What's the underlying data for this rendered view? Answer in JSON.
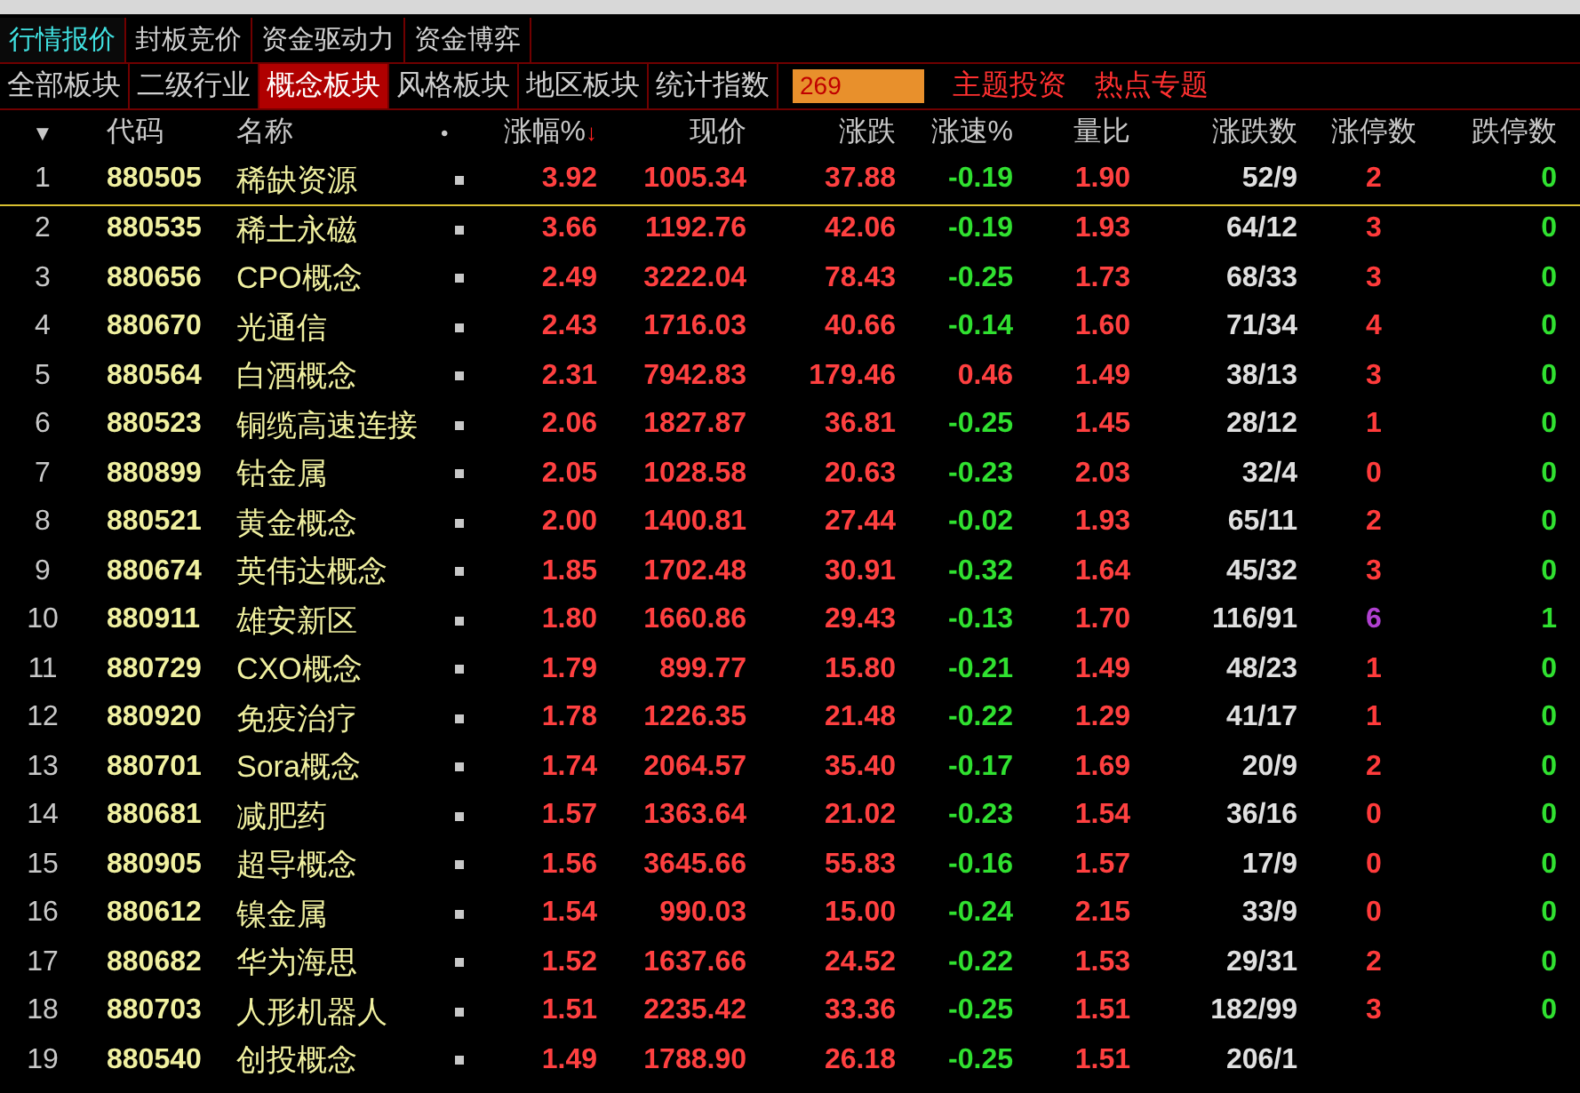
{
  "top_tabs": [
    {
      "label": "行情报价",
      "selected": true
    },
    {
      "label": "封板竞价",
      "selected": false
    },
    {
      "label": "资金驱动力",
      "selected": false
    },
    {
      "label": "资金博弈",
      "selected": false
    }
  ],
  "category_tabs": [
    {
      "label": "全部板块",
      "selected": false
    },
    {
      "label": "二级行业",
      "selected": false
    },
    {
      "label": "概念板块",
      "selected": true
    },
    {
      "label": "风格板块",
      "selected": false
    },
    {
      "label": "地区板块",
      "selected": false
    },
    {
      "label": "统计指数",
      "selected": false
    }
  ],
  "count_field": {
    "value": "269"
  },
  "links": [
    "主题投资",
    "热点专题"
  ],
  "columns": {
    "menu": "▼",
    "code": "代码",
    "name": "名称",
    "dot": "•",
    "change_pct": "涨幅%",
    "sort_mark": "↓",
    "price": "现价",
    "change": "涨跌",
    "speed": "涨速%",
    "volume_ratio": "量比",
    "up_down": "涨跌数",
    "limit_up": "涨停数",
    "limit_down": "跌停数"
  },
  "rows": [
    {
      "index": "1",
      "code": "880505",
      "name": "稀缺资源",
      "change_pct": "3.92",
      "price": "1005.34",
      "change": "37.88",
      "speed": "-0.19",
      "speed_rising": false,
      "volume_ratio": "1.90",
      "up_down": "52/9",
      "limit_up": {
        "text": "2",
        "color": "#ff3b3b"
      },
      "limit_down": "0",
      "selected": true
    },
    {
      "index": "2",
      "code": "880535",
      "name": "稀土永磁",
      "change_pct": "3.66",
      "price": "1192.76",
      "change": "42.06",
      "speed": "-0.19",
      "speed_rising": false,
      "volume_ratio": "1.93",
      "up_down": "64/12",
      "limit_up": {
        "text": "3",
        "color": "#ff3b3b"
      },
      "limit_down": "0",
      "selected": false
    },
    {
      "index": "3",
      "code": "880656",
      "name": "CPO概念",
      "change_pct": "2.49",
      "price": "3222.04",
      "change": "78.43",
      "speed": "-0.25",
      "speed_rising": false,
      "volume_ratio": "1.73",
      "up_down": "68/33",
      "limit_up": {
        "text": "3",
        "color": "#ff3b3b"
      },
      "limit_down": "0",
      "selected": false
    },
    {
      "index": "4",
      "code": "880670",
      "name": "光通信",
      "change_pct": "2.43",
      "price": "1716.03",
      "change": "40.66",
      "speed": "-0.14",
      "speed_rising": false,
      "volume_ratio": "1.60",
      "up_down": "71/34",
      "limit_up": {
        "text": "4",
        "color": "#ff3b3b"
      },
      "limit_down": "0",
      "selected": false
    },
    {
      "index": "5",
      "code": "880564",
      "name": "白酒概念",
      "change_pct": "2.31",
      "price": "7942.83",
      "change": "179.46",
      "speed": "0.46",
      "speed_rising": true,
      "volume_ratio": "1.49",
      "up_down": "38/13",
      "limit_up": {
        "text": "3",
        "color": "#ff3b3b"
      },
      "limit_down": "0",
      "selected": false
    },
    {
      "index": "6",
      "code": "880523",
      "name": "铜缆高速连接",
      "change_pct": "2.06",
      "price": "1827.87",
      "change": "36.81",
      "speed": "-0.25",
      "speed_rising": false,
      "volume_ratio": "1.45",
      "up_down": "28/12",
      "limit_up": {
        "text": "1",
        "color": "#ff3b3b"
      },
      "limit_down": "0",
      "selected": false
    },
    {
      "index": "7",
      "code": "880899",
      "name": "钴金属",
      "change_pct": "2.05",
      "price": "1028.58",
      "change": "20.63",
      "speed": "-0.23",
      "speed_rising": false,
      "volume_ratio": "2.03",
      "up_down": "32/4",
      "limit_up": {
        "text": "0",
        "color": "#ff3b3b"
      },
      "limit_down": "0",
      "selected": false
    },
    {
      "index": "8",
      "code": "880521",
      "name": "黄金概念",
      "change_pct": "2.00",
      "price": "1400.81",
      "change": "27.44",
      "speed": "-0.02",
      "speed_rising": false,
      "volume_ratio": "1.93",
      "up_down": "65/11",
      "limit_up": {
        "text": "2",
        "color": "#ff3b3b"
      },
      "limit_down": "0",
      "selected": false
    },
    {
      "index": "9",
      "code": "880674",
      "name": "英伟达概念",
      "change_pct": "1.85",
      "price": "1702.48",
      "change": "30.91",
      "speed": "-0.32",
      "speed_rising": false,
      "volume_ratio": "1.64",
      "up_down": "45/32",
      "limit_up": {
        "text": "3",
        "color": "#ff3b3b"
      },
      "limit_down": "0",
      "selected": false
    },
    {
      "index": "10",
      "code": "880911",
      "name": "雄安新区",
      "change_pct": "1.80",
      "price": "1660.86",
      "change": "29.43",
      "speed": "-0.13",
      "speed_rising": false,
      "volume_ratio": "1.70",
      "up_down": "116/91",
      "limit_up": {
        "text": "6",
        "color": "#b040d0"
      },
      "limit_down": "1",
      "selected": false
    },
    {
      "index": "11",
      "code": "880729",
      "name": "CXO概念",
      "change_pct": "1.79",
      "price": "899.77",
      "change": "15.80",
      "speed": "-0.21",
      "speed_rising": false,
      "volume_ratio": "1.49",
      "up_down": "48/23",
      "limit_up": {
        "text": "1",
        "color": "#ff3b3b"
      },
      "limit_down": "0",
      "selected": false
    },
    {
      "index": "12",
      "code": "880920",
      "name": "免疫治疗",
      "change_pct": "1.78",
      "price": "1226.35",
      "change": "21.48",
      "speed": "-0.22",
      "speed_rising": false,
      "volume_ratio": "1.29",
      "up_down": "41/17",
      "limit_up": {
        "text": "1",
        "color": "#ff3b3b"
      },
      "limit_down": "0",
      "selected": false
    },
    {
      "index": "13",
      "code": "880701",
      "name": "Sora概念",
      "change_pct": "1.74",
      "price": "2064.57",
      "change": "35.40",
      "speed": "-0.17",
      "speed_rising": false,
      "volume_ratio": "1.69",
      "up_down": "20/9",
      "limit_up": {
        "text": "2",
        "color": "#ff3b3b"
      },
      "limit_down": "0",
      "selected": false
    },
    {
      "index": "14",
      "code": "880681",
      "name": "减肥药",
      "change_pct": "1.57",
      "price": "1363.64",
      "change": "21.02",
      "speed": "-0.23",
      "speed_rising": false,
      "volume_ratio": "1.54",
      "up_down": "36/16",
      "limit_up": {
        "text": "0",
        "color": "#ff3b3b"
      },
      "limit_down": "0",
      "selected": false
    },
    {
      "index": "15",
      "code": "880905",
      "name": "超导概念",
      "change_pct": "1.56",
      "price": "3645.66",
      "change": "55.83",
      "speed": "-0.16",
      "speed_rising": false,
      "volume_ratio": "1.57",
      "up_down": "17/9",
      "limit_up": {
        "text": "0",
        "color": "#ff3b3b"
      },
      "limit_down": "0",
      "selected": false
    },
    {
      "index": "16",
      "code": "880612",
      "name": "镍金属",
      "change_pct": "1.54",
      "price": "990.03",
      "change": "15.00",
      "speed": "-0.24",
      "speed_rising": false,
      "volume_ratio": "2.15",
      "up_down": "33/9",
      "limit_up": {
        "text": "0",
        "color": "#ff3b3b"
      },
      "limit_down": "0",
      "selected": false
    },
    {
      "index": "17",
      "code": "880682",
      "name": "华为海思",
      "change_pct": "1.52",
      "price": "1637.66",
      "change": "24.52",
      "speed": "-0.22",
      "speed_rising": false,
      "volume_ratio": "1.53",
      "up_down": "29/31",
      "limit_up": {
        "text": "2",
        "color": "#ff3b3b"
      },
      "limit_down": "0",
      "selected": false
    },
    {
      "index": "18",
      "code": "880703",
      "name": "人形机器人",
      "change_pct": "1.51",
      "price": "2235.42",
      "change": "33.36",
      "speed": "-0.25",
      "speed_rising": false,
      "volume_ratio": "1.51",
      "up_down": "182/99",
      "limit_up": {
        "text": "3",
        "color": "#ff3b3b"
      },
      "limit_down": "0",
      "selected": false
    },
    {
      "index": "19",
      "code": "880540",
      "name": "创投概念",
      "change_pct": "1.49",
      "price": "1788.90",
      "change": "26.18",
      "speed": "-0.25",
      "speed_rising": false,
      "volume_ratio": "1.51",
      "up_down": "206/1",
      "selected": false
    }
  ]
}
